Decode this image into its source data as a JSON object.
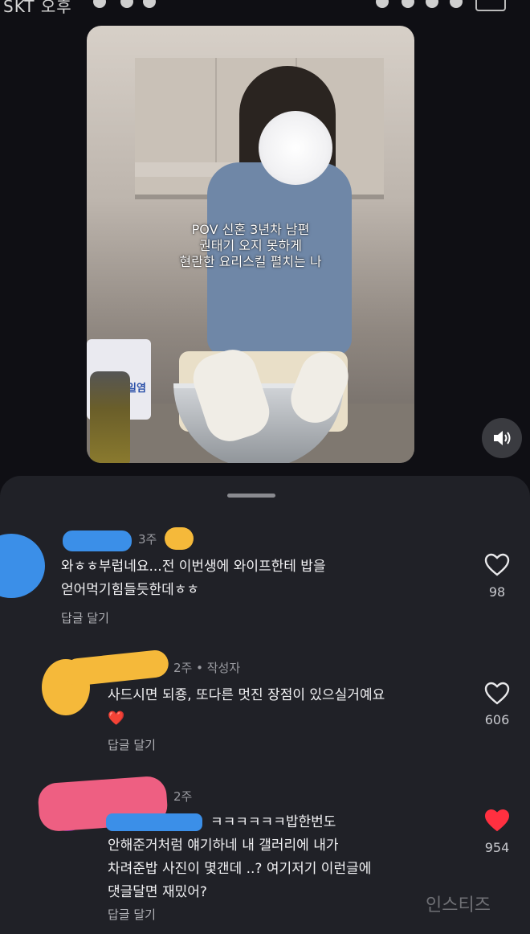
{
  "status_bar": {
    "carrier": "SKT 오후"
  },
  "video": {
    "caption_lines": [
      "POV 신혼 3년차 남편",
      "권태기 오지 못하게",
      "현란한 요리스킬 펼치는 나"
    ],
    "bag_label": "일염"
  },
  "comments": [
    {
      "age": "3주",
      "text_lines": [
        "와ㅎㅎ부럽네요...전 이번생에 와이프한테 밥을",
        "얻어먹기힘들듯한데ㅎㅎ"
      ],
      "reply": "답글 달기",
      "likes": "98",
      "liked": false
    },
    {
      "age": "2주 • 작성자",
      "text_lines": [
        "사드시면 되죵, 또다른 멋진 장점이 있으실거예요",
        "❤️"
      ],
      "reply": "답글 달기",
      "likes": "606",
      "liked": false
    },
    {
      "age": "2주",
      "text_lines": [
        "ㅋㅋㅋㅋㅋㅋ밥한번도",
        "안해준거처럼 얘기하네 내 갤러리에 내가",
        "차려준밥 사진이 몇갠데 ..? 여기저기 이런글에",
        "댓글달면 재밌어?"
      ],
      "reply": "답글 달기",
      "likes": "954",
      "liked": true
    }
  ],
  "watermark": "인스티즈",
  "colors": {
    "like_red": "#ff3040",
    "sheet_bg": "#202127",
    "page_bg": "#0f0f14"
  }
}
